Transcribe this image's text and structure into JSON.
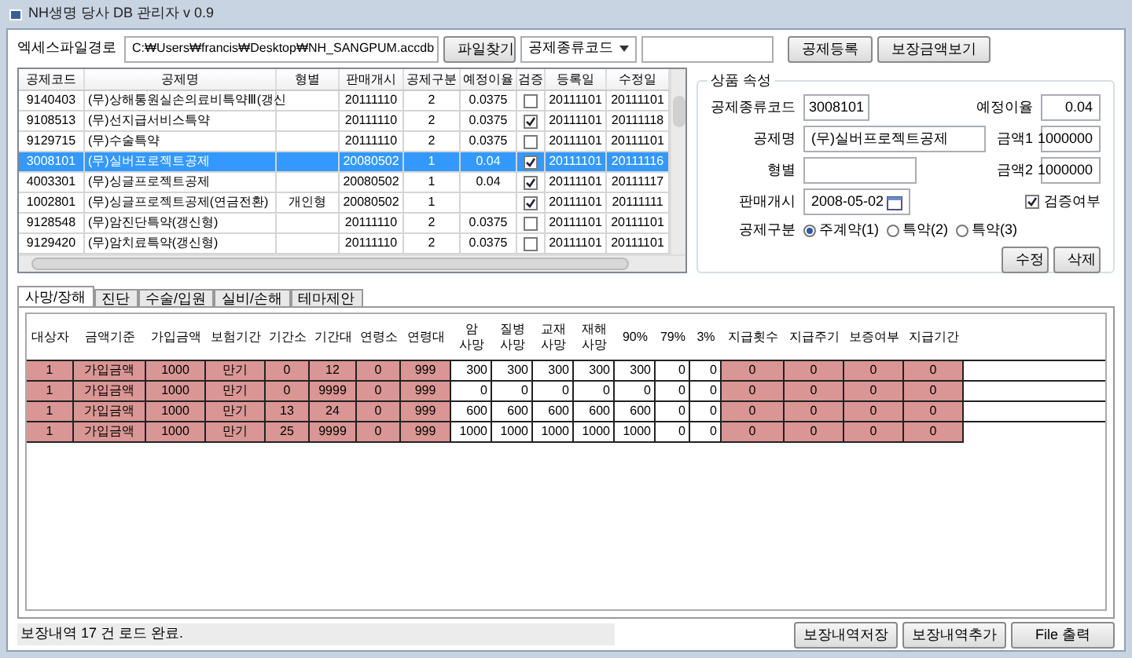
{
  "window": {
    "title": "NH생명 당사 DB 관리자 v 0.9"
  },
  "toolbar": {
    "path_label": "엑세스파일경로",
    "path_value": "C:₩Users₩francis₩Desktop₩NH_SANGPUM.accdb",
    "browse_button": "파일찾기",
    "code_dropdown": "공제종류코드",
    "register_button": "공제등록",
    "view_button": "보장금액보기"
  },
  "products": {
    "columns": [
      "공제코드",
      "공제명",
      "형별",
      "판매개시",
      "공제구분",
      "예정이율",
      "검증",
      "등록일",
      "수정일"
    ],
    "rows": [
      {
        "code": "9140403",
        "name": "(무)상해통원실손의료비특약Ⅲ(갱신",
        "type": "",
        "start": "20111110",
        "division": "2",
        "rate": "0.0375",
        "verified": false,
        "registered": "20111101",
        "modified": "20111101",
        "selected": false
      },
      {
        "code": "9108513",
        "name": "(무)선지급서비스특약",
        "type": "",
        "start": "20111110",
        "division": "2",
        "rate": "0.0375",
        "verified": true,
        "registered": "20111101",
        "modified": "20111118",
        "selected": false
      },
      {
        "code": "9129715",
        "name": "(무)수술특약",
        "type": "",
        "start": "20111110",
        "division": "2",
        "rate": "0.0375",
        "verified": false,
        "registered": "20111101",
        "modified": "20111101",
        "selected": false
      },
      {
        "code": "3008101",
        "name": "(무)실버프로젝트공제",
        "type": "",
        "start": "20080502",
        "division": "1",
        "rate": "0.04",
        "verified": true,
        "registered": "20111101",
        "modified": "20111116",
        "selected": true
      },
      {
        "code": "4003301",
        "name": "(무)싱글프로젝트공제",
        "type": "",
        "start": "20080502",
        "division": "1",
        "rate": "0.04",
        "verified": true,
        "registered": "20111101",
        "modified": "20111117",
        "selected": false
      },
      {
        "code": "1002801",
        "name": "(무)싱글프로젝트공제(연금전환)",
        "type": "개인형",
        "start": "20080502",
        "division": "1",
        "rate": "",
        "verified": true,
        "registered": "20111101",
        "modified": "20111111",
        "selected": false
      },
      {
        "code": "9128548",
        "name": "(무)암진단특약(갱신형)",
        "type": "",
        "start": "20111110",
        "division": "2",
        "rate": "0.0375",
        "verified": false,
        "registered": "20111101",
        "modified": "20111101",
        "selected": false
      },
      {
        "code": "9129420",
        "name": "(무)암치료특약(갱신형)",
        "type": "",
        "start": "20111110",
        "division": "2",
        "rate": "0.0375",
        "verified": false,
        "registered": "20111101",
        "modified": "20111101",
        "selected": false
      }
    ]
  },
  "attributes": {
    "title": "상품 속성",
    "code_label": "공제종류코드",
    "code_value": "3008101",
    "rate_label": "예정이율",
    "rate_value": "0.04",
    "name_label": "공제명",
    "name_value": "(무)실버프로젝트공제",
    "amount1_label": "금액1",
    "amount1_value": "1000000",
    "type_label": "형별",
    "amount2_label": "금액2",
    "amount2_value": "1000000",
    "start_label": "판매개시",
    "start_value": "2008-05-02",
    "verified_label": "검증여부",
    "verified": true,
    "division_label": "공제구분",
    "divisions": [
      {
        "label": "주계약(1)",
        "selected": true
      },
      {
        "label": "특약(2)",
        "selected": false
      },
      {
        "label": "특약(3)",
        "selected": false
      }
    ],
    "edit_button": "수정",
    "delete_button": "삭제"
  },
  "tabs": [
    {
      "label": "사망/장해",
      "selected": true
    },
    {
      "label": "진단",
      "selected": false
    },
    {
      "label": "수술/입원",
      "selected": false
    },
    {
      "label": "실비/손해",
      "selected": false
    },
    {
      "label": "테마제안",
      "selected": false
    }
  ],
  "coverage": {
    "columns": [
      {
        "label": "대상자",
        "highlighted": true
      },
      {
        "label": "금액기준",
        "highlighted": true
      },
      {
        "label": "가입금액",
        "highlighted": true
      },
      {
        "label": "보험기간",
        "highlighted": true
      },
      {
        "label": "기간소",
        "highlighted": true
      },
      {
        "label": "기간대",
        "highlighted": true
      },
      {
        "label": "연령소",
        "highlighted": true
      },
      {
        "label": "연령대",
        "highlighted": true
      },
      {
        "label": "암 사망",
        "highlighted": false
      },
      {
        "label": "질병 사망",
        "highlighted": false
      },
      {
        "label": "교재 사망",
        "highlighted": false
      },
      {
        "label": "재해 사망",
        "highlighted": false
      },
      {
        "label": "90%",
        "highlighted": false
      },
      {
        "label": "79%",
        "highlighted": false
      },
      {
        "label": "3%",
        "highlighted": false
      },
      {
        "label": "지급횟수",
        "highlighted": true
      },
      {
        "label": "지급주기",
        "highlighted": true
      },
      {
        "label": "보증여부",
        "highlighted": true
      },
      {
        "label": "지급기간",
        "highlighted": true
      }
    ],
    "rows": [
      [
        "1",
        "가입금액",
        "1000",
        "만기",
        "0",
        "12",
        "0",
        "999",
        "300",
        "300",
        "300",
        "300",
        "300",
        "0",
        "0",
        "0",
        "0",
        "0",
        "0"
      ],
      [
        "1",
        "가입금액",
        "1000",
        "만기",
        "0",
        "9999",
        "0",
        "999",
        "0",
        "0",
        "0",
        "0",
        "0",
        "0",
        "0",
        "0",
        "0",
        "0",
        "0"
      ],
      [
        "1",
        "가입금액",
        "1000",
        "만기",
        "13",
        "24",
        "0",
        "999",
        "600",
        "600",
        "600",
        "600",
        "600",
        "0",
        "0",
        "0",
        "0",
        "0",
        "0"
      ],
      [
        "1",
        "가입금액",
        "1000",
        "만기",
        "25",
        "9999",
        "0",
        "999",
        "1000",
        "1000",
        "1000",
        "1000",
        "1000",
        "0",
        "0",
        "0",
        "0",
        "0",
        "0"
      ]
    ]
  },
  "status_bar": {
    "message": "보장내역 17 건 로드 완료.",
    "buttons": [
      "보장내역저장",
      "보장내역추가",
      "File 출력"
    ]
  }
}
